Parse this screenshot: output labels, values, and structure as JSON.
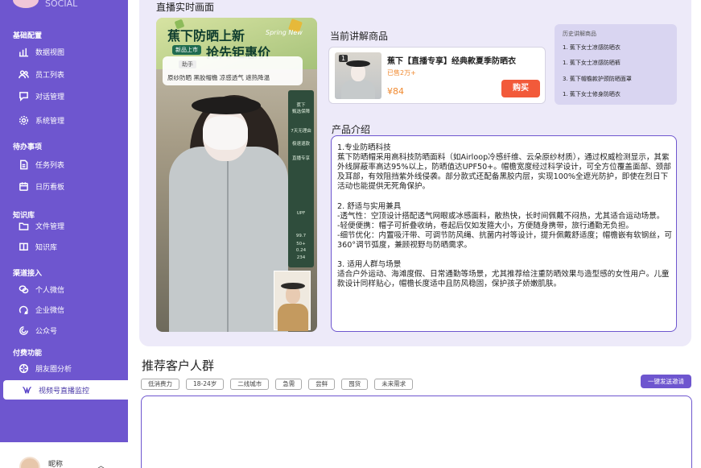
{
  "sidebar": {
    "logo_text": "SOCIAL",
    "sections": [
      {
        "title": "基础配置",
        "items": [
          {
            "label": "数据视图",
            "icon": "bar-chart-icon"
          },
          {
            "label": "员工列表",
            "icon": "users-icon"
          },
          {
            "label": "对话管理",
            "icon": "chat-icon"
          },
          {
            "label": "系统管理",
            "icon": "gear-icon"
          }
        ]
      },
      {
        "title": "待办事项",
        "items": [
          {
            "label": "任务列表",
            "icon": "document-icon"
          },
          {
            "label": "日历看板",
            "icon": "calendar-icon"
          }
        ]
      },
      {
        "title": "知识库",
        "items": [
          {
            "label": "文件管理",
            "icon": "folder-icon"
          },
          {
            "label": "知识库",
            "icon": "book-icon"
          }
        ]
      },
      {
        "title": "渠道接入",
        "items": [
          {
            "label": "个人微信",
            "icon": "wechat-icon"
          },
          {
            "label": "企业微信",
            "icon": "wecom-icon"
          },
          {
            "label": "公众号",
            "icon": "official-account-icon"
          }
        ]
      },
      {
        "title": "付费功能",
        "items": [
          {
            "label": "朋友圈分析",
            "icon": "moments-icon"
          },
          {
            "label": "视频号直播监控",
            "icon": "channels-icon",
            "active": true
          }
        ]
      }
    ],
    "user": {
      "nickname": "昵称"
    }
  },
  "live": {
    "heading": "直播实时画面",
    "video": {
      "banner_top": "蕉下防晒上新",
      "banner_bottom": "抢先钜惠价",
      "spring": "Spring New",
      "new_tag": "新品上市",
      "assist": "助手",
      "caption_tags": "原纱防晒 黑胶帽檐 凉感透气 遮热降温",
      "board_lines": [
        "蕉下",
        "甄选保障",
        "7天无理由",
        "极速退款",
        "直播专享",
        "UPF",
        "99.7",
        "50+",
        "0.24",
        "234"
      ]
    }
  },
  "current_product": {
    "title": "当前讲解商品",
    "index": "1",
    "name": "蕉下【直播专享】经典款夏季防晒衣",
    "sold": "已售2万+",
    "price": "¥84",
    "buy_label": "购买"
  },
  "history": {
    "title": "历史讲解商品",
    "items": [
      "1. 蕉下女士凉感防晒衣",
      "1. 蕉下女士凉感防晒裤",
      "3. 蕉下帽檐款护颈防晒面罩",
      "1. 蕉下女士修身防晒衣"
    ]
  },
  "intro": {
    "title": "产品介绍",
    "text": "1.专业防晒科技\n蕉下防晒帽采用高科技防晒面料（如Airloop冷感纤维、云朵原纱材质），通过权威检测显示，其紫外线屏蔽率高达95%以上，防晒值达UPF50+。帽檐宽度经过科学设计，可全方位覆盖面部、颈部及耳部，有效阻挡紫外线侵袭。部分款式还配备黑胶内层，实现100%全遮光防护，即使在烈日下活动也能提供无死角保护。\n\n2. 舒适与实用兼具\n-透气性：空顶设计搭配透气网眼或冰感面料，散热快，长时间佩戴不闷热，尤其适合运动场景。\n-轻便便携：帽子可折叠收纳，卷起后仅如发箍大小，方便随身携带，旅行通勤无负担。\n-细节优化：内置吸汗带、可调节防风绳、抗菌内衬等设计，提升佩戴舒适度；帽檐嵌有软钢丝，可360°调节弧度，兼顾视野与防晒需求。\n\n3. 适用人群与场景\n适合户外运动、海滩度假、日常通勤等场景，尤其推荐给注重防晒效果与造型感的女性用户。儿童款设计同样贴心，帽檐长度适中且防风稳固，保护孩子娇嫩肌肤。"
  },
  "recommend": {
    "title": "推荐客户人群",
    "tags": [
      "低消费力",
      "18-24岁",
      "二线城市",
      "急需",
      "尝鲜",
      "囤货",
      "未来需求"
    ],
    "send_label": "一键发送邀请"
  },
  "colors": {
    "accent": "#6e56cf",
    "buy": "#f25a3a",
    "price": "#f0892f",
    "panel": "#edeaf9"
  }
}
